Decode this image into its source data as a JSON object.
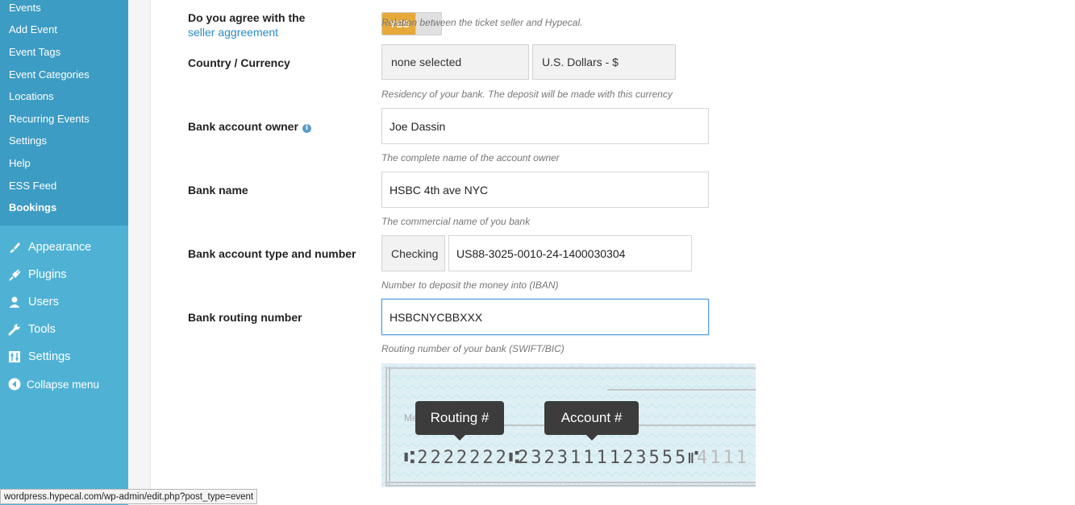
{
  "sidebar": {
    "submenu": [
      {
        "label": "Events"
      },
      {
        "label": "Add Event"
      },
      {
        "label": "Event Tags"
      },
      {
        "label": "Event Categories"
      },
      {
        "label": "Locations"
      },
      {
        "label": "Recurring Events"
      },
      {
        "label": "Settings"
      },
      {
        "label": "Help"
      },
      {
        "label": "ESS Feed"
      },
      {
        "label": "Bookings"
      }
    ],
    "menu": [
      {
        "label": "Appearance",
        "icon": "brush-icon"
      },
      {
        "label": "Plugins",
        "icon": "plug-icon"
      },
      {
        "label": "Users",
        "icon": "user-icon"
      },
      {
        "label": "Tools",
        "icon": "wrench-icon"
      },
      {
        "label": "Settings",
        "icon": "settings-icon"
      },
      {
        "label": "Collapse menu",
        "icon": "collapse-icon"
      }
    ]
  },
  "form": {
    "agreement": {
      "label": "Do you agree with the",
      "link": "seller aggreement",
      "toggle": "YES",
      "hint": "Relation between the ticket seller and Hypecal."
    },
    "country": {
      "label": "Country / Currency",
      "country_value": "none selected",
      "currency_value": "U.S. Dollars - $",
      "hint": "Residency of your bank. The deposit will be made with this currency"
    },
    "owner": {
      "label": "Bank account owner",
      "value": "Joe Dassin",
      "hint": "The complete name of the account owner"
    },
    "bank_name": {
      "label": "Bank name",
      "value": "HSBC 4th ave NYC",
      "hint": "The commercial name of you bank"
    },
    "account": {
      "label": "Bank account type and number",
      "type": "Checking",
      "number": "US88-3025-0010-24-1400030304",
      "hint": "Number to deposit the money into (IBAN)"
    },
    "routing": {
      "label": "Bank routing number",
      "value": "HSBCNYCBBXXX",
      "hint": "Routing number of your bank (SWIFT/BIC)"
    }
  },
  "check": {
    "routing_tip": "Routing #",
    "account_tip": "Account #",
    "routing_digits": "⑆2222222⑆",
    "account_digits": "2323111123555⑈",
    "check_number": "4111",
    "memo": "Me"
  },
  "status_url": "wordpress.hypecal.com/wp-admin/edit.php?post_type=event",
  "colors": {
    "sidebar": "#4fb2d4",
    "submenu": "#3d9cc4",
    "toggle_on": "#e6a93a",
    "link": "#2a8ac4"
  }
}
